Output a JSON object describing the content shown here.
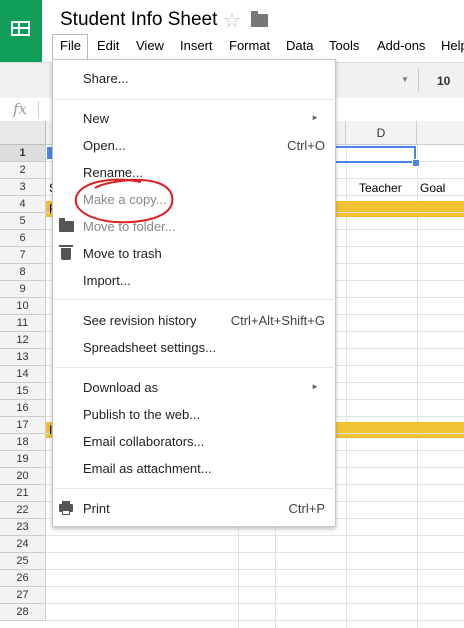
{
  "app": {
    "title": "Student Info Sheet",
    "icons": {
      "logo": "sheets-logo-icon",
      "star": "star-icon",
      "folder": "folder-icon"
    }
  },
  "menubar": [
    "File",
    "Edit",
    "View",
    "Insert",
    "Format",
    "Data",
    "Tools",
    "Add-ons",
    "Help"
  ],
  "toolbar": {
    "font": "rial",
    "font_size": "10"
  },
  "formula_bar": {
    "fx": "fx"
  },
  "grid": {
    "column_d": "D",
    "rows": [
      "1",
      "2",
      "3",
      "4",
      "5",
      "6",
      "7",
      "8",
      "9",
      "10",
      "11",
      "12",
      "13",
      "14",
      "15",
      "16",
      "17",
      "18",
      "19",
      "20",
      "21",
      "22",
      "23",
      "24",
      "25",
      "26",
      "27",
      "28"
    ],
    "row3_cells": {
      "a": "S",
      "c": "Teacher",
      "d": "Goal"
    },
    "row4_a": "F",
    "row17_a": "I",
    "highlight_color": "#f1c232"
  },
  "file_menu": {
    "items": [
      {
        "label": "Share...",
        "shortcut": ""
      },
      {
        "label": "New",
        "shortcut": "",
        "submenu": true
      },
      {
        "label": "Open...",
        "shortcut": "Ctrl+O"
      },
      {
        "label": "Rename...",
        "shortcut": ""
      },
      {
        "label": "Make a copy...",
        "shortcut": ""
      },
      {
        "label": "Move to folder...",
        "shortcut": "",
        "icon": "folder-icon"
      },
      {
        "label": "Move to trash",
        "shortcut": "",
        "icon": "trash-icon"
      },
      {
        "label": "Import...",
        "shortcut": ""
      },
      {
        "label": "See revision history",
        "shortcut": "Ctrl+Alt+Shift+G"
      },
      {
        "label": "Spreadsheet settings...",
        "shortcut": ""
      },
      {
        "label": "Download as",
        "shortcut": "",
        "submenu": true
      },
      {
        "label": "Publish to the web...",
        "shortcut": ""
      },
      {
        "label": "Email collaborators...",
        "shortcut": ""
      },
      {
        "label": "Email as attachment...",
        "shortcut": ""
      },
      {
        "label": "Print",
        "shortcut": "Ctrl+P",
        "icon": "print-icon"
      }
    ],
    "annotation_color": "#e02020"
  }
}
